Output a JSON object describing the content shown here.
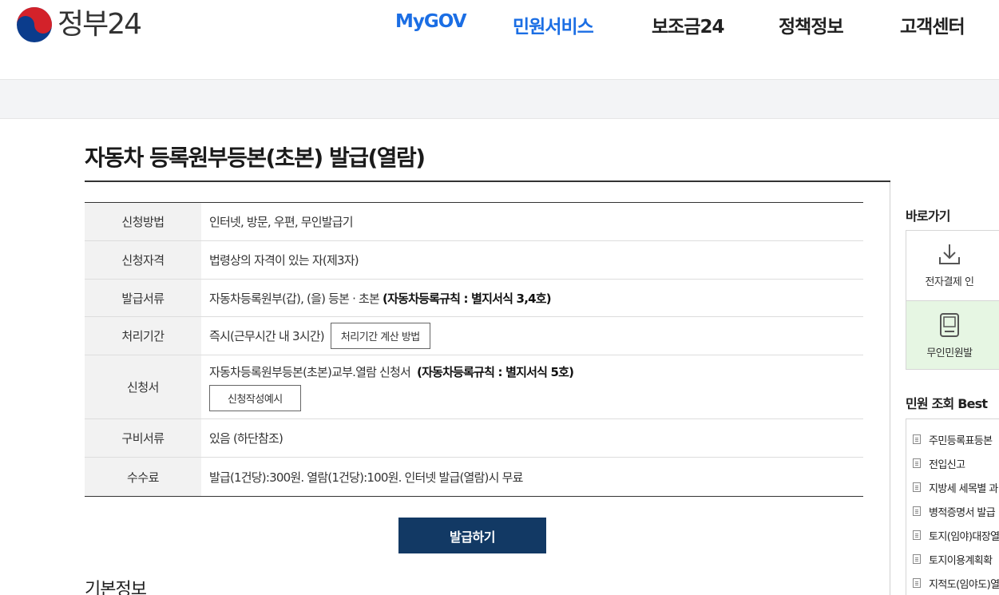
{
  "brand": {
    "logo_text": "정부24"
  },
  "nav": [
    {
      "label": "MyGOV",
      "active": true
    },
    {
      "label": "민원서비스",
      "active": true
    },
    {
      "label": "보조금24",
      "active": false
    },
    {
      "label": "정책정보",
      "active": false
    },
    {
      "label": "고객센터",
      "active": false
    }
  ],
  "page": {
    "title": "자동차 등록원부등본(초본) 발급(열람)",
    "apply_button": "발급하기",
    "section_title": "기본정보"
  },
  "info": {
    "method": {
      "label": "신청방법",
      "value": "인터넷, 방문, 우편, 무인발급기"
    },
    "qualification": {
      "label": "신청자격",
      "value": "법령상의 자격이 있는 자(제3자)"
    },
    "documents": {
      "label": "발급서류",
      "value": "자동차등록원부(갑), (을) 등본 · 초본",
      "bold": "(자동차등록규칙 : 별지서식 3,4호)"
    },
    "period": {
      "label": "처리기간",
      "value": "즉시(근무시간 내 3시간)",
      "button": "처리기간 계산 방법"
    },
    "form": {
      "label": "신청서",
      "value": "자동차등록원부등본(초본)교부.열람 신청서",
      "bold": "(자동차등록규칙 : 별지서식 5호)",
      "button": "신청작성예시"
    },
    "required": {
      "label": "구비서류",
      "value": "있음 (하단참조)"
    },
    "fee": {
      "label": "수수료",
      "value": "발급(1건당):300원. 열람(1건당):100원. 인터넷 발급(열람)시 무료"
    }
  },
  "sidebar": {
    "quick_title": "바로가기",
    "quick_items": [
      {
        "label": "전자결제 인",
        "icon": "download-icon"
      },
      {
        "label": "무인민원발",
        "icon": "kiosk-icon"
      }
    ],
    "best_title": "민원 조회 Best",
    "best_items": [
      "주민등록표등본",
      "전입신고",
      "지방세 세목별 과",
      "병적증명서 발급",
      "토지(임야)대장열",
      "토지이용계획확",
      "지적도(임야도)열"
    ]
  },
  "colors": {
    "nav_active": "#1b6ee4",
    "primary_button": "#123964",
    "quick_highlight": "#e6f6e3"
  }
}
